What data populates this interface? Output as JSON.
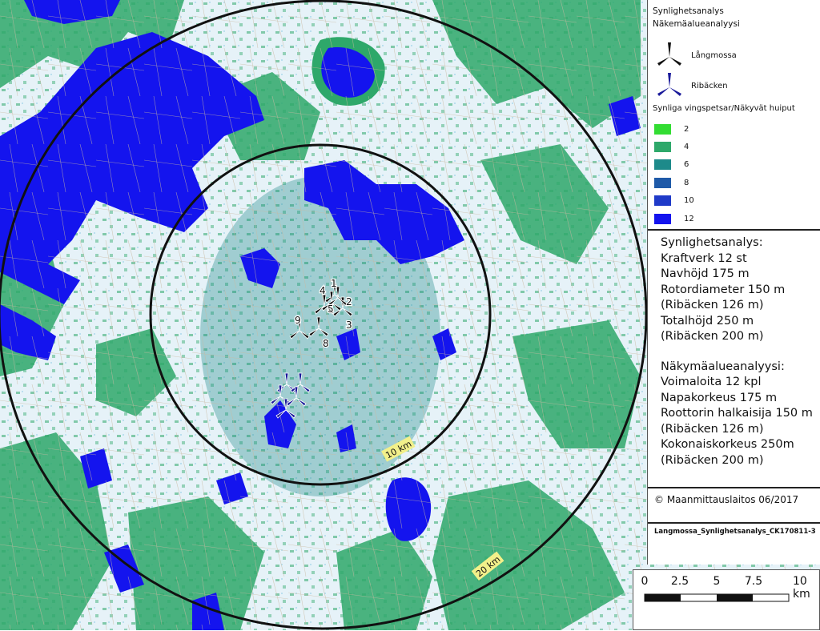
{
  "legend": {
    "title_sv": "Synlighetsanalys",
    "title_fi": "Näkemäalueanalyysi",
    "turbine_groups": [
      {
        "label": "Långmossa",
        "icon": "turbine-icon",
        "color": "#111111"
      },
      {
        "label": "Ribäcken",
        "icon": "turbine-icon",
        "color": "#1a1a9a"
      }
    ],
    "classes_title": "Synliga vingspetsar/Näkyvät huiput",
    "classes": [
      {
        "label": "2",
        "color": "#33dd33"
      },
      {
        "label": "4",
        "color": "#2ea86a"
      },
      {
        "label": "6",
        "color": "#1d8a8a"
      },
      {
        "label": "8",
        "color": "#1f5aa8"
      },
      {
        "label": "10",
        "color": "#1f3ac8"
      },
      {
        "label": "12",
        "color": "#1414ee"
      }
    ],
    "analysis_sv": [
      "Synlighetsanalys:",
      "Kraftverk 12 st",
      "Navhöjd 175 m",
      "Rotordiameter 150 m",
      "(Ribäcken 126 m)",
      "Totalhöjd 250 m",
      "(Ribäcken 200 m)"
    ],
    "analysis_fi": [
      "Näkymäalueanalyysi:",
      "Voimaloita 12 kpl",
      "Napakorkeus 175 m",
      "Roottorin halkaisija 150 m",
      "(Ribäcken 126 m)",
      "Kokonaiskorkeus 250m",
      "(Ribäcken 200 m)"
    ],
    "credit": "© Maanmittauslaitos 06/2017",
    "reference": "Langmossa_Synlighetsanalys_CK170811-3"
  },
  "scalebar": {
    "ticks": [
      "0",
      "2.5",
      "5",
      "7.5",
      "10 km"
    ]
  },
  "map": {
    "rings": [
      {
        "label": "10 km"
      },
      {
        "label": "20 km"
      }
    ],
    "turbine_numbers": [
      "1",
      "2",
      "3",
      "4",
      "5",
      "8",
      "9"
    ],
    "colors": {
      "base": "#e6f2f8",
      "forest_green": "#2ea86a",
      "water_blue": "#1414ee",
      "ring": "#111111",
      "ring_label_bg": "#f2f08a"
    }
  }
}
